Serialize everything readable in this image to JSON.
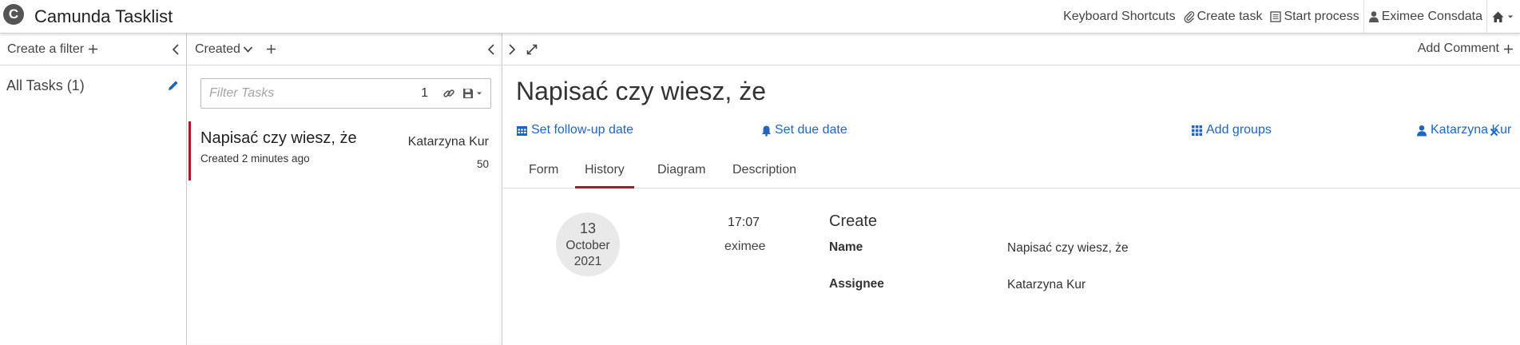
{
  "header": {
    "logo_letter": "C",
    "app_title": "Camunda Tasklist",
    "nav": {
      "keyboard_shortcuts": "Keyboard Shortcuts",
      "create_task": "Create task",
      "start_process": "Start process",
      "user": "Eximee Consdata"
    }
  },
  "filters": {
    "create_filter_label": "Create a filter",
    "items": [
      {
        "label": "All Tasks (1)"
      }
    ]
  },
  "task_list": {
    "sort_label": "Created",
    "search": {
      "placeholder": "Filter Tasks",
      "count": "1"
    },
    "tasks": [
      {
        "name": "Napisać czy wiesz, że",
        "assignee": "Katarzyna Kur",
        "created": "Created 2 minutes ago",
        "priority": "50"
      }
    ]
  },
  "task_detail": {
    "add_comment": "Add Comment",
    "title": "Napisać czy wiesz, że",
    "actions": {
      "follow_up": "Set follow-up date",
      "due_date": "Set due date",
      "add_groups": "Add groups",
      "assignee": "Katarzyna Kur"
    },
    "tabs": [
      "Form",
      "History",
      "Diagram",
      "Description"
    ],
    "active_tab": "History",
    "history": {
      "date_day": "13",
      "date_month": "October",
      "date_year": "2021",
      "time": "17:07",
      "user": "eximee",
      "operation": "Create",
      "fields": [
        {
          "label": "Name",
          "value": "Napisać czy wiesz, że"
        },
        {
          "label": "Assignee",
          "value": "Katarzyna Kur"
        }
      ]
    }
  },
  "colors": {
    "accent": "#b5152b",
    "link": "#1e66c0"
  }
}
